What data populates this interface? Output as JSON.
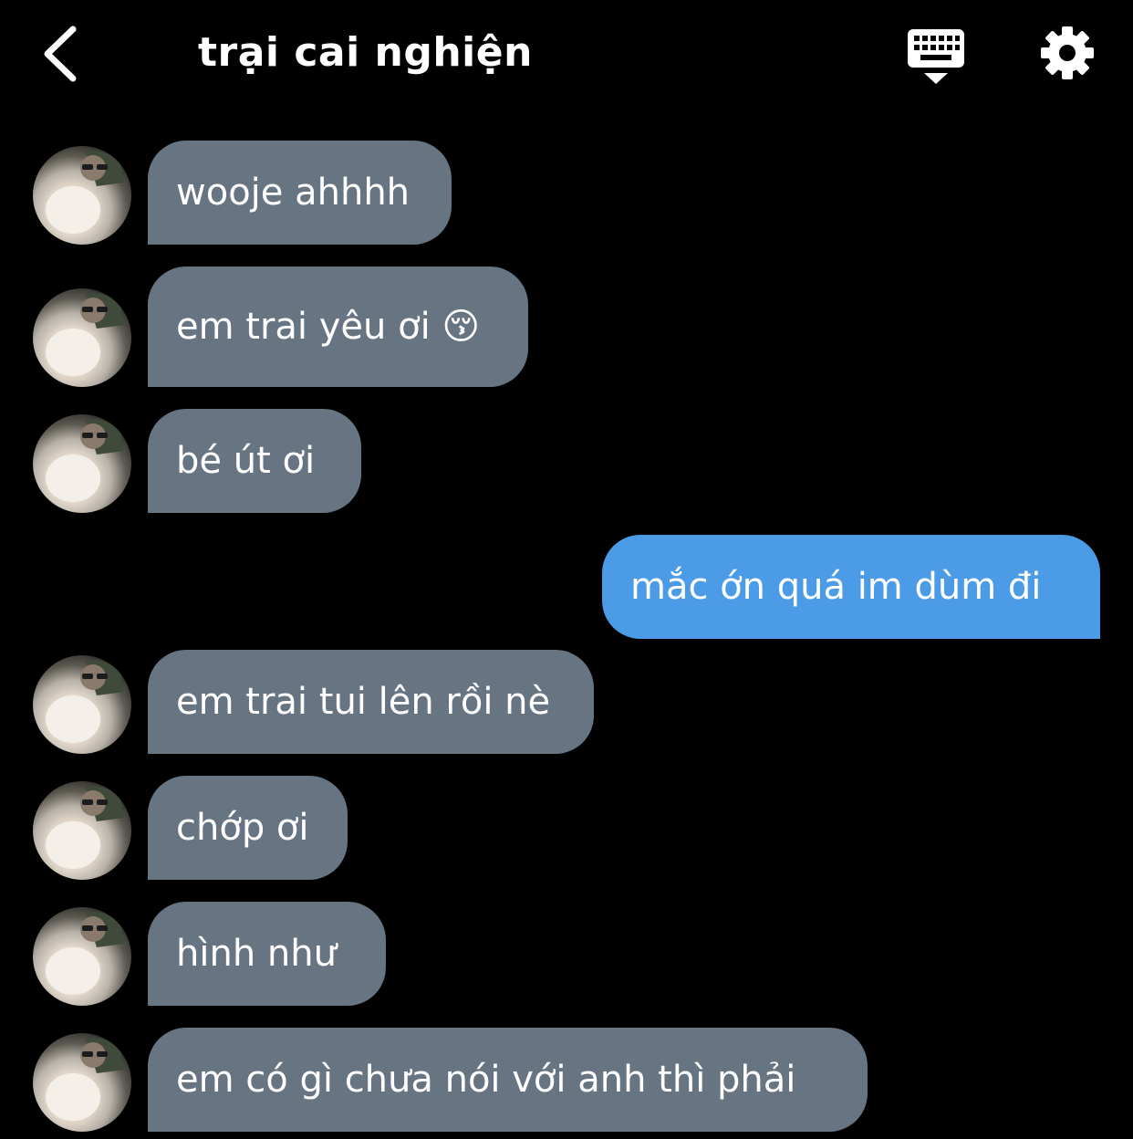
{
  "header": {
    "title": "trại cai nghiện"
  },
  "messages": [
    {
      "direction": "in",
      "text": "wooje ahhhh"
    },
    {
      "direction": "in",
      "text": "em trai yêu ơi 😚"
    },
    {
      "direction": "in",
      "text": "bé út ơi"
    },
    {
      "direction": "out",
      "text": "mắc ớn quá im dùm đi"
    },
    {
      "direction": "in",
      "text": "em trai tui lên rồi nè"
    },
    {
      "direction": "in",
      "text": "chớp ơi"
    },
    {
      "direction": "in",
      "text": "hình như"
    },
    {
      "direction": "in",
      "text": "em có gì chưa nói với anh thì phải"
    }
  ],
  "icons": {
    "back": "chevron-left-icon",
    "keyboard": "keyboard-hide-icon",
    "settings": "gear-icon"
  },
  "colors": {
    "background": "#000000",
    "incoming_bubble": "#677482",
    "outgoing_bubble": "#4b9be6",
    "text": "#ffffff"
  }
}
